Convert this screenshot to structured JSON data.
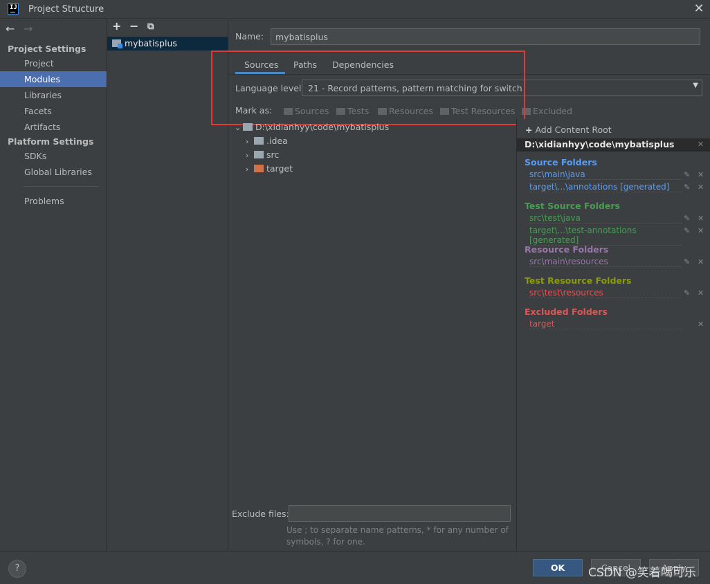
{
  "window": {
    "title": "Project Structure"
  },
  "nav": {
    "groups": [
      {
        "title": "Project Settings",
        "items": [
          "Project",
          "Modules",
          "Libraries",
          "Facets",
          "Artifacts"
        ]
      },
      {
        "title": "Platform Settings",
        "items": [
          "SDKs",
          "Global Libraries"
        ]
      }
    ],
    "problems": "Problems",
    "selected": "Modules"
  },
  "modules": {
    "items": [
      "mybatisplus"
    ]
  },
  "name": {
    "label": "Name:",
    "value": "mybatisplus"
  },
  "tabs": [
    "Sources",
    "Paths",
    "Dependencies"
  ],
  "active_tab": "Sources",
  "language": {
    "label": "Language level:",
    "value": "21 - Record patterns, pattern matching for switch"
  },
  "mark_as": {
    "label": "Mark as:",
    "buttons": [
      "Sources",
      "Tests",
      "Resources",
      "Test Resources",
      "Excluded"
    ]
  },
  "tree": {
    "root": "D:\\xidianhyy\\code\\mybatisplus",
    "children": [
      {
        "name": ".idea",
        "color": "gray"
      },
      {
        "name": "src",
        "color": "gray"
      },
      {
        "name": "target",
        "color": "orange"
      }
    ]
  },
  "roots": {
    "add_label": "Add Content Root",
    "path": "D:\\xidianhyy\\code\\mybatisplus",
    "source": {
      "title": "Source Folders",
      "color": "#589df6",
      "items": [
        "src\\main\\java",
        "target\\...\\annotations [generated]"
      ]
    },
    "test_source": {
      "title": "Test Source Folders",
      "color": "#499c54",
      "items": [
        "src\\test\\java",
        "target\\...\\test-annotations [generated]"
      ]
    },
    "resource": {
      "title": "Resource Folders",
      "color": "#9876aa",
      "items": [
        "src\\main\\resources"
      ]
    },
    "test_resource": {
      "title": "Test Resource Folders",
      "color": "#8c9b0b",
      "items": [
        "src\\test\\resources"
      ]
    },
    "excluded": {
      "title": "Excluded Folders",
      "color": "#e05555",
      "items": [
        "target"
      ]
    }
  },
  "exclude": {
    "label": "Exclude files:",
    "value": "",
    "hint": "Use ; to separate name patterns, * for any number of symbols, ? for one."
  },
  "buttons": {
    "ok": "OK",
    "cancel": "Cancel",
    "apply": "Apply",
    "help": "?"
  },
  "watermark": "CSDN @笑着喝可乐"
}
